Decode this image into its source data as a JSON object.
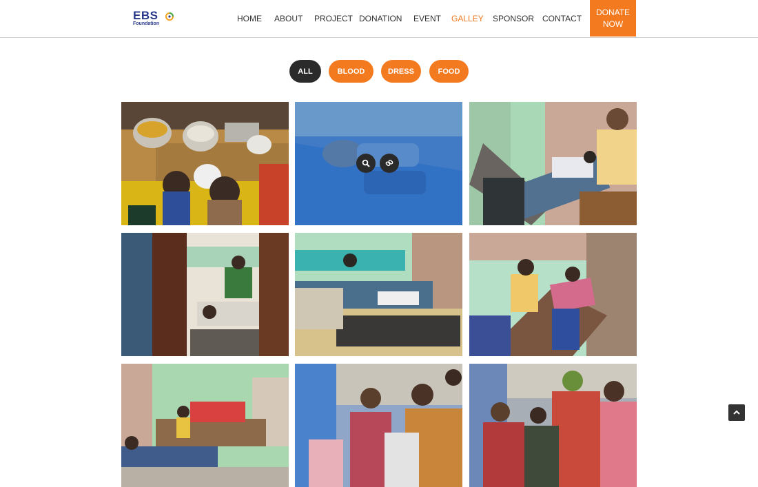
{
  "header": {
    "logo": {
      "name": "EBS",
      "sub": "Foundation"
    },
    "nav": [
      {
        "label": "HOME",
        "active": false
      },
      {
        "label": "ABOUT",
        "active": false
      },
      {
        "label": "PROJECT",
        "active": false
      },
      {
        "label": "DONATION",
        "active": false
      },
      {
        "label": "EVENT",
        "active": false
      },
      {
        "label": "GALLEY",
        "active": true
      },
      {
        "label": "SPONSOR",
        "active": false
      },
      {
        "label": "CONTACT",
        "active": false
      }
    ],
    "donate": {
      "line1": "DONATE",
      "line2": "NOW"
    }
  },
  "filters": [
    {
      "label": "ALL",
      "active": true
    },
    {
      "label": "BLOOD",
      "active": false
    },
    {
      "label": "DRESS",
      "active": false
    },
    {
      "label": "FOOD",
      "active": false
    }
  ],
  "gallery": {
    "photos": [
      {
        "subject": "food-distribution-photo"
      },
      {
        "subject": "blood-donor-photo",
        "hovered": true
      },
      {
        "subject": "blood-donation-camp-photo"
      },
      {
        "subject": "blood-donation-room-photo"
      },
      {
        "subject": "blood-donors-beds-photo"
      },
      {
        "subject": "blood-donor-lying-photo"
      },
      {
        "subject": "camp-hall-photo"
      },
      {
        "subject": "dress-distribution-crowd-photo"
      },
      {
        "subject": "women-children-crowd-photo"
      }
    ],
    "overlay_icons": [
      "search-icon",
      "link-icon"
    ]
  },
  "colors": {
    "accent": "#f47a20",
    "dark": "#2b2b2b",
    "overlay": "#1e78dc"
  },
  "scroll_top_icon": "chevron-up-icon"
}
